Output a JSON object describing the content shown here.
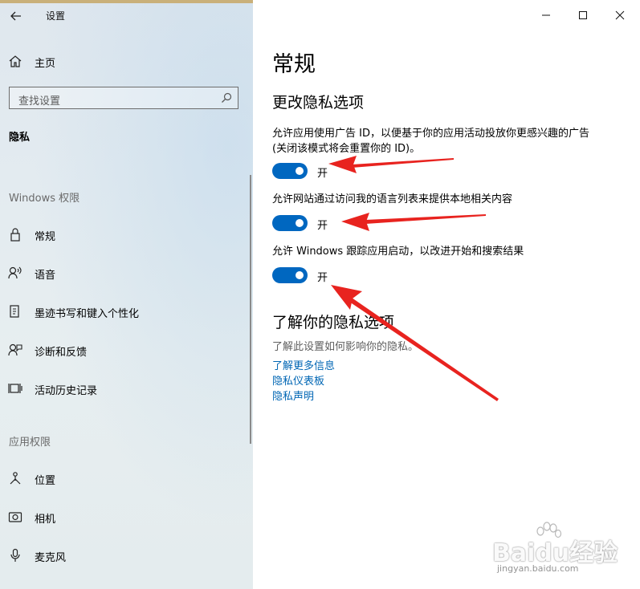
{
  "window": {
    "title": "设置"
  },
  "sidebar": {
    "home_label": "主页",
    "search_placeholder": "查找设置",
    "current_group": "隐私",
    "sections": [
      {
        "title": "Windows 权限",
        "items": [
          {
            "label": "常规",
            "icon": "lock-icon"
          },
          {
            "label": "语音",
            "icon": "speech-icon"
          },
          {
            "label": "墨迹书写和键入个性化",
            "icon": "ink-icon"
          },
          {
            "label": "诊断和反馈",
            "icon": "feedback-icon"
          },
          {
            "label": "活动历史记录",
            "icon": "activity-history-icon"
          }
        ]
      },
      {
        "title": "应用权限",
        "items": [
          {
            "label": "位置",
            "icon": "location-icon"
          },
          {
            "label": "相机",
            "icon": "camera-icon"
          },
          {
            "label": "麦克风",
            "icon": "microphone-icon"
          }
        ]
      }
    ]
  },
  "main": {
    "page_title": "常规",
    "section_title": "更改隐私选项",
    "settings": [
      {
        "text_line1": "允许应用使用广告 ID，以便基于你的应用活动投放你更感兴趣的广告",
        "text_line2": "(关闭该模式将会重置你的 ID)。",
        "state": "开",
        "on": true
      },
      {
        "text_line1": "允许网站通过访问我的语言列表来提供本地相关内容",
        "state": "开",
        "on": true
      },
      {
        "text_line1": "允许 Windows 跟踪应用启动，以改进开始和搜索结果",
        "state": "开",
        "on": true
      }
    ],
    "learn": {
      "title": "了解你的隐私选项",
      "desc": "了解此设置如何影响你的隐私。",
      "links": [
        "了解更多信息",
        "隐私仪表板",
        "隐私声明"
      ]
    }
  },
  "watermark": {
    "main": "Baidu经验",
    "sub": "jingyan.baidu.com"
  },
  "colors": {
    "accent": "#0067c0",
    "link": "#0066b4",
    "annotation": "#e8231f"
  }
}
